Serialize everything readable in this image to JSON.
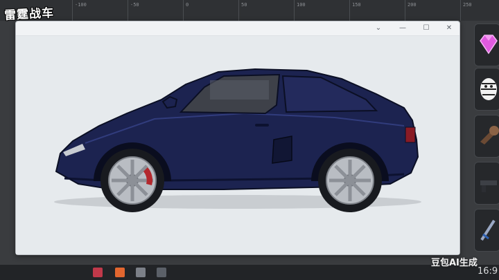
{
  "app": {
    "logo_text": "雷霆战车"
  },
  "ruler": {
    "labels": [
      "-100",
      "-50",
      "0",
      "50",
      "100",
      "150",
      "200",
      "250"
    ]
  },
  "window": {
    "controls": {
      "collapse": "⌄",
      "minimize": "—",
      "maximize": "☐",
      "close": "✕"
    }
  },
  "canvas": {
    "subject": "dark-blue-sports-car",
    "body_color": "#1c2350"
  },
  "side_panel": {
    "items": [
      "gem-icon",
      "zebra-mascot-icon",
      "wrench-icon",
      "gun-icon",
      "sword-icon"
    ]
  },
  "taskbar": {
    "items": [
      "app-icon-1",
      "app-icon-2",
      "app-icon-3",
      "app-icon-4"
    ]
  },
  "watermark": "豆包AI生成",
  "aspect_ratio": "16:9"
}
